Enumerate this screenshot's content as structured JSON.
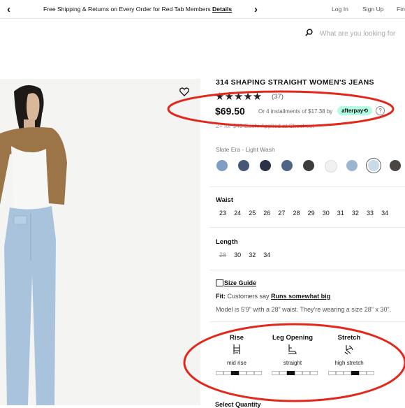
{
  "promo_bar": {
    "text": "Free Shipping & Returns on Every Order for Red Tab Members",
    "link": "Details",
    "prev_arrow": "‹",
    "next_arrow": "›"
  },
  "header": {
    "login": "Log In",
    "signup": "Sign Up",
    "find": "Fin",
    "search_placeholder": "What are you looking for"
  },
  "product": {
    "title": "314 SHAPING STRAIGHT WOMEN'S JEANS",
    "rating": 4.5,
    "stars": "★★★★★",
    "review_count": "(37)",
    "price": "$69.50",
    "installments": "Or 4 installments of $17.38 by",
    "afterpay_label": "afterpay⟲",
    "help": "?",
    "promo_line": "2+ for $45 Each: Applied at Checkout",
    "color_label": "Slate Era - Light Wash",
    "swatch_colors": [
      "#7f9ec4",
      "#465775",
      "#2b3247",
      "#4f6586",
      "#3d3d3f",
      "#f1f1f1",
      "#9db6d0",
      "#c9dbe9",
      "#4b4644"
    ],
    "selected_swatch": 7,
    "waist_label": "Waist",
    "waist_sizes": [
      "23",
      "24",
      "25",
      "26",
      "27",
      "28",
      "29",
      "30",
      "31",
      "32",
      "33",
      "34"
    ],
    "length_label": "Length",
    "length_sizes": [
      "28",
      "30",
      "32",
      "34"
    ],
    "length_unavailable": [
      "28"
    ],
    "size_guide": "Size Guide",
    "fit_prefix": "Fit:",
    "fit_text": "Customers say",
    "fit_value": "Runs somewhat big",
    "model_line": "Model is 5'9\" with a 28\" waist. They're wearing a size 28\" x 30\".",
    "features": [
      {
        "title": "Rise",
        "value": "mid rise",
        "icon": "rise-icon",
        "level": 3
      },
      {
        "title": "Leg Opening",
        "value": "straight",
        "icon": "leg-opening-icon",
        "level": 3
      },
      {
        "title": "Stretch",
        "value": "high stretch",
        "icon": "stretch-icon",
        "level": 4
      }
    ],
    "select_quantity": "Select Quantity"
  },
  "colors": {
    "annotation_red": "#e3271b",
    "afterpay_mint": "#b2fce4"
  }
}
